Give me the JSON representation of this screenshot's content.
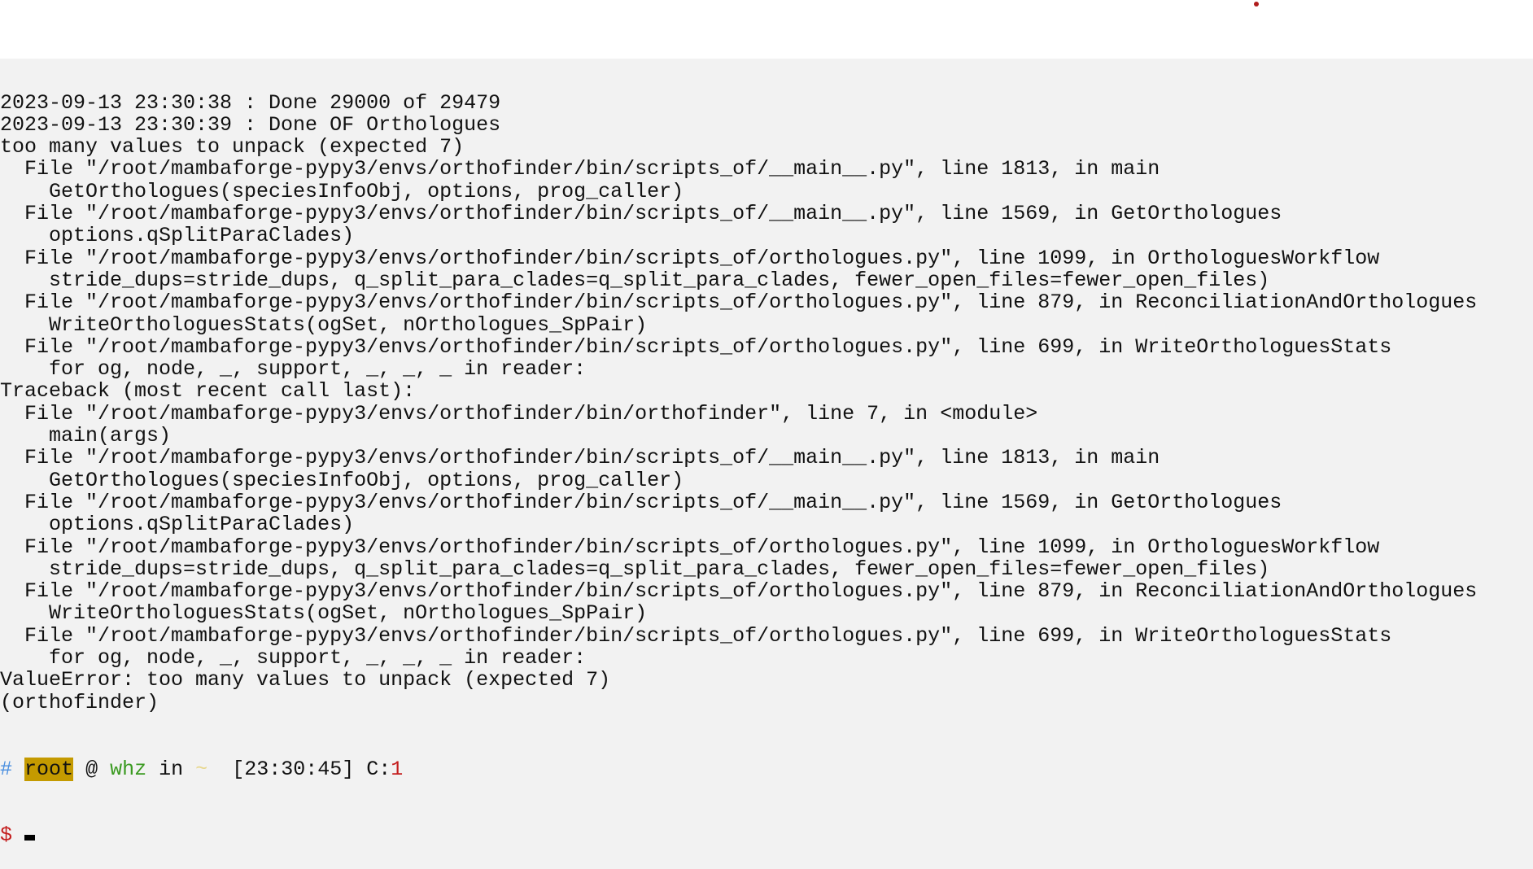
{
  "terminal": {
    "lines": [
      "2023-09-13 23:30:38 : Done 29000 of 29479",
      "2023-09-13 23:30:39 : Done OF Orthologues",
      "too many values to unpack (expected 7)",
      "  File \"/root/mambaforge-pypy3/envs/orthofinder/bin/scripts_of/__main__.py\", line 1813, in main",
      "    GetOrthologues(speciesInfoObj, options, prog_caller)",
      "  File \"/root/mambaforge-pypy3/envs/orthofinder/bin/scripts_of/__main__.py\", line 1569, in GetOrthologues",
      "    options.qSplitParaClades)",
      "  File \"/root/mambaforge-pypy3/envs/orthofinder/bin/scripts_of/orthologues.py\", line 1099, in OrthologuesWorkflow",
      "    stride_dups=stride_dups, q_split_para_clades=q_split_para_clades, fewer_open_files=fewer_open_files)",
      "  File \"/root/mambaforge-pypy3/envs/orthofinder/bin/scripts_of/orthologues.py\", line 879, in ReconciliationAndOrthologues",
      "    WriteOrthologuesStats(ogSet, nOrthologues_SpPair)",
      "  File \"/root/mambaforge-pypy3/envs/orthofinder/bin/scripts_of/orthologues.py\", line 699, in WriteOrthologuesStats",
      "    for og, node, _, support, _, _, _ in reader:",
      "Traceback (most recent call last):",
      "  File \"/root/mambaforge-pypy3/envs/orthofinder/bin/orthofinder\", line 7, in <module>",
      "    main(args)",
      "  File \"/root/mambaforge-pypy3/envs/orthofinder/bin/scripts_of/__main__.py\", line 1813, in main",
      "    GetOrthologues(speciesInfoObj, options, prog_caller)",
      "  File \"/root/mambaforge-pypy3/envs/orthofinder/bin/scripts_of/__main__.py\", line 1569, in GetOrthologues",
      "    options.qSplitParaClades)",
      "  File \"/root/mambaforge-pypy3/envs/orthofinder/bin/scripts_of/orthologues.py\", line 1099, in OrthologuesWorkflow",
      "    stride_dups=stride_dups, q_split_para_clades=q_split_para_clades, fewer_open_files=fewer_open_files)",
      "  File \"/root/mambaforge-pypy3/envs/orthofinder/bin/scripts_of/orthologues.py\", line 879, in ReconciliationAndOrthologues",
      "    WriteOrthologuesStats(ogSet, nOrthologues_SpPair)",
      "  File \"/root/mambaforge-pypy3/envs/orthofinder/bin/scripts_of/orthologues.py\", line 699, in WriteOrthologuesStats",
      "    for og, node, _, support, _, _, _ in reader:",
      "ValueError: too many values to unpack (expected 7)",
      "(orthofinder)"
    ],
    "prompt": {
      "hash": "#",
      "user": "root",
      "at": "@",
      "host": "whz",
      "in": "in",
      "dir": "~",
      "time": "[23:30:45]",
      "code_label": "C:",
      "code": "1",
      "symbol": "$"
    },
    "colors": {
      "background": "#f2f2f2",
      "hash": "#4a8fe0",
      "user_bg": "#c49a00",
      "host": "#3a9a20",
      "error": "#c41e1e"
    }
  }
}
